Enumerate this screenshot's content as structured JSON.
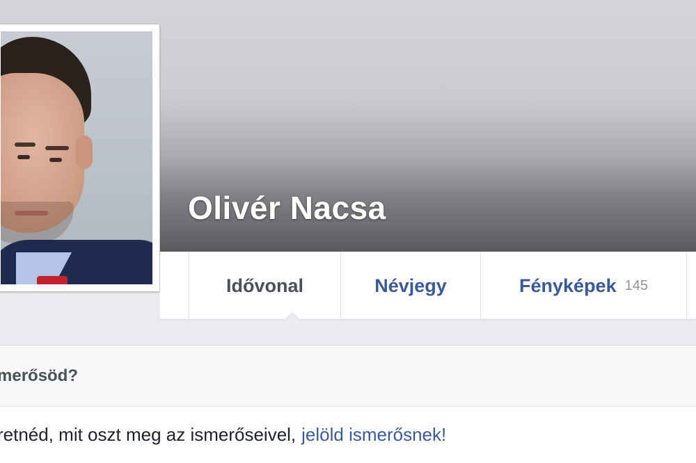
{
  "profile": {
    "name": "Olivér Nacsa"
  },
  "nav": {
    "tabs": [
      {
        "label": "Idővonal",
        "active": true
      },
      {
        "label": "Névjegy"
      },
      {
        "label": "Fényképek",
        "count": "145"
      }
    ]
  },
  "friend_prompt": {
    "title": "merősöd?",
    "text": "retnéd, mit oszt meg az ismerőseivel,",
    "link": "jelöld ismerősnek!"
  },
  "colors": {
    "link_blue": "#3b5998",
    "active_tab_text": "#4b4f56"
  }
}
